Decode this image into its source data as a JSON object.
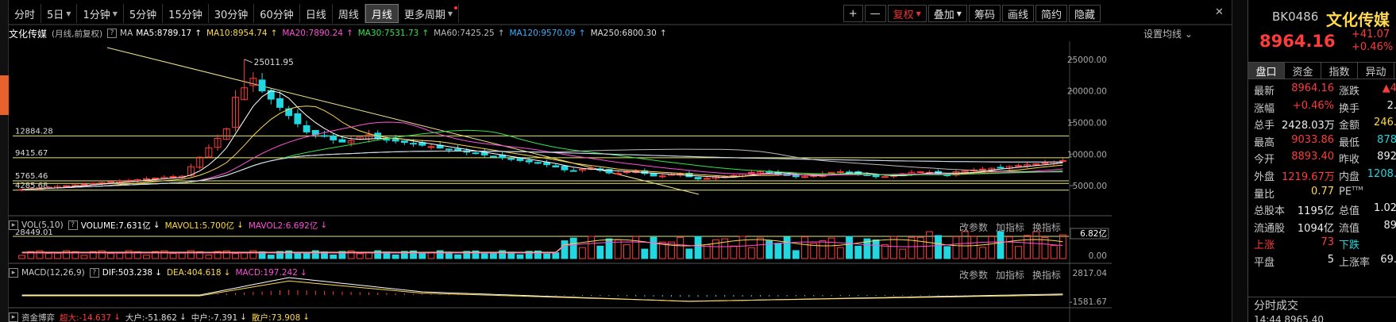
{
  "toolbar": {
    "periods": [
      "分时",
      "5日",
      "1分钟",
      "5分钟",
      "15分钟",
      "30分钟",
      "60分钟",
      "日线",
      "周线",
      "月线",
      "更多周期"
    ],
    "active_period": "月线",
    "right_buttons": [
      "+",
      "—",
      "复权",
      "叠加",
      "筹码",
      "画线",
      "简约",
      "隐藏"
    ]
  },
  "header": {
    "title": "文化传媒",
    "subtitle": "(月线,前复权)",
    "ma_label": "MA",
    "ma_items": [
      {
        "text": "MA5:8789.17",
        "color": "#ffffff"
      },
      {
        "text": "MA10:8954.74",
        "color": "#ffd84d"
      },
      {
        "text": "MA20:7890.24",
        "color": "#ff4fd8"
      },
      {
        "text": "MA30:7531.73",
        "color": "#34e34a"
      },
      {
        "text": "MA60:7425.25",
        "color": "#bbbbbb"
      },
      {
        "text": "MA120:9570.09",
        "color": "#3ab0ff"
      },
      {
        "text": "MA250:6800.30",
        "color": "#dddddd"
      }
    ],
    "setting": "设置均线"
  },
  "price_axis": [
    "25000.00",
    "20000.00",
    "15000.00",
    "10000.00",
    "5000.00"
  ],
  "levels": [
    {
      "label": "12884.28",
      "value": 12884.28
    },
    {
      "label": "9415.67",
      "value": 9415.67
    },
    {
      "label": "5765.46",
      "value": 5765.46
    },
    {
      "label": "4285.68",
      "value": 4285.68
    }
  ],
  "peak_label": "25011.95",
  "volume": {
    "label": "VOL(5,10)",
    "items": [
      {
        "text": "VOLUME:7.631亿",
        "color": "#ffffff"
      },
      {
        "text": "MAVOL1:5.700亿",
        "color": "#ffd84d"
      },
      {
        "text": "MAVOL2:6.692亿",
        "color": "#ff4fd8"
      }
    ],
    "left_value": "28449.01",
    "axis": [
      "6.82亿",
      "0.00"
    ]
  },
  "macd": {
    "label": "MACD(12,26,9)",
    "items": [
      {
        "text": "DIF:503.238",
        "color": "#ffffff"
      },
      {
        "text": "DEA:404.618",
        "color": "#ffd84d"
      },
      {
        "text": "MACD:197.242",
        "color": "#ff4fd8"
      }
    ],
    "axis": [
      "2817.04",
      "-1581.67"
    ]
  },
  "funds": {
    "label": "资金博弈",
    "items": [
      {
        "text": "超大:-14.637",
        "color": "#ff3b3b"
      },
      {
        "text": "大户:-51.862",
        "color": "#dddddd"
      },
      {
        "text": "中户:-7.391",
        "color": "#dddddd"
      },
      {
        "text": "散户:73.908",
        "color": "#ffd84d"
      }
    ]
  },
  "sub_actions": [
    "改参数",
    "加指标",
    "换指标"
  ],
  "quote": {
    "code": "BK0486",
    "name": "文化传媒",
    "price": "8964.16",
    "change": "+41.07",
    "change_pct": "+0.46%",
    "tabs": [
      "盘口",
      "资金",
      "指数",
      "异动"
    ],
    "rows": [
      {
        "l1": "最新",
        "v1": "8964.16",
        "c1": "red",
        "l2": "涨跌",
        "v2": "▲4",
        "c2": "red"
      },
      {
        "l1": "涨幅",
        "v1": "+0.46%",
        "c1": "red",
        "l2": "换手",
        "v2": "2.",
        "c2": "white"
      },
      {
        "l1": "总手",
        "v1": "2428.03万",
        "c1": "white",
        "l2": "金额",
        "v2": "246.",
        "c2": "yellow"
      },
      {
        "l1": "最高",
        "v1": "9033.86",
        "c1": "red",
        "l2": "最低",
        "v2": "878",
        "c2": "green"
      },
      {
        "l1": "今开",
        "v1": "8893.40",
        "c1": "red",
        "l2": "昨收",
        "v2": "892",
        "c2": "white"
      },
      {
        "l1": "外盘",
        "v1": "1219.67万",
        "c1": "red",
        "l2": "内盘",
        "v2": "1208.",
        "c2": "green"
      },
      {
        "l1": "量比",
        "v1": "0.77",
        "c1": "yellow",
        "l2": "PE",
        "v2": "",
        "c2": "white"
      },
      {
        "l1": "总股本",
        "v1": "1195亿",
        "c1": "white",
        "l2": "总值",
        "v2": "1.02",
        "c2": "white"
      },
      {
        "l1": "流通股",
        "v1": "1094亿",
        "c1": "white",
        "l2": "流值",
        "v2": "89",
        "c2": "white"
      },
      {
        "l1": "上涨",
        "v1": "73",
        "c1": "red",
        "l2": "下跌",
        "v2": "",
        "c2": "green"
      },
      {
        "l1": "平盘",
        "v1": "5",
        "c1": "white",
        "l2": "上涨率",
        "v2": "69.",
        "c2": "white"
      }
    ],
    "pe_sup": "TTM",
    "footer": "分时成交",
    "footer2": "14:44   8965.40"
  }
}
